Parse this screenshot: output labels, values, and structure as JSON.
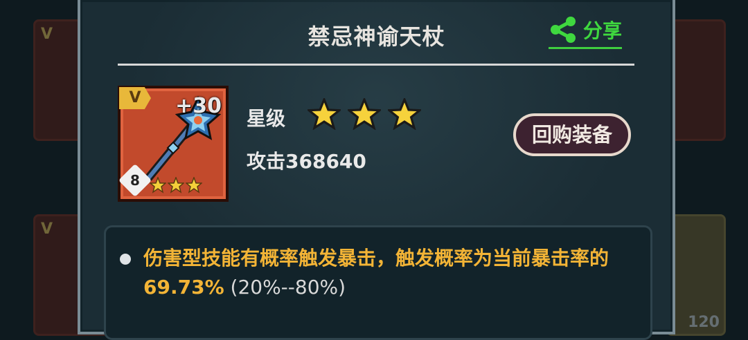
{
  "item": {
    "name": "禁忌神谕天杖",
    "badge": "V",
    "plus_level": "+30",
    "lock_number": "8",
    "mini_star_count": 3
  },
  "share": {
    "label": "分享",
    "icon": "share-icon"
  },
  "stats": {
    "star_label": "星级",
    "star_count": 3,
    "attack_text": "攻击368640"
  },
  "actions": {
    "buyback_label": "回购装备"
  },
  "description": {
    "main": "伤害型技能有概率触发暴击，触发概率为当前暴击率的69.73%",
    "range": " (20%--80%)"
  },
  "background": {
    "left_top_badge": "V",
    "left_bottom_badge": "V",
    "right_bottom_level": "120"
  },
  "colors": {
    "accent_green": "#3fd83f",
    "desc_text": "#f3b436",
    "panel_bg": "#1b2d35",
    "item_frame": "#c24a2c"
  }
}
